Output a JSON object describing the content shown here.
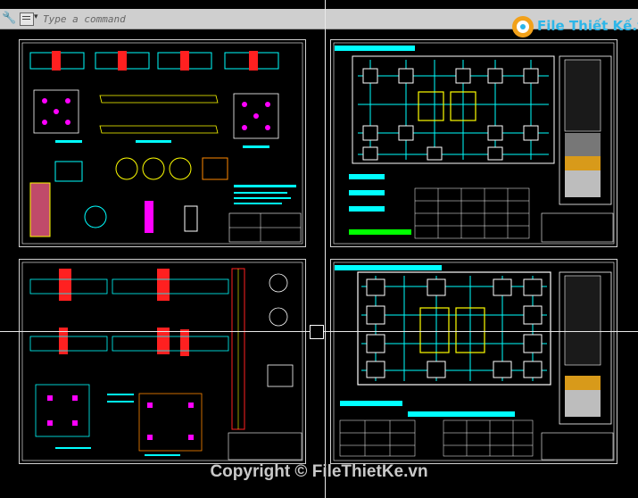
{
  "command_line": {
    "placeholder": "Type a command",
    "tool_icon": "wrench-icon",
    "history_icon": "command-history-icon"
  },
  "logo": {
    "text": "File Thiết Kế.vn",
    "icon": "filethietke-logo-icon"
  },
  "sheets": [
    {
      "id": "sheet-top-left",
      "title_block": ""
    },
    {
      "id": "sheet-top-right",
      "title_block": ""
    },
    {
      "id": "sheet-bottom-left",
      "title_block": ""
    },
    {
      "id": "sheet-bottom-right",
      "title_block": ""
    }
  ],
  "footer": {
    "copyright": "Copyright © FileThietKe.vn"
  },
  "colors": {
    "background": "#000000",
    "cyan": "#00ffff",
    "yellow": "#ffff00",
    "red": "#ff2020",
    "magenta": "#ff00ff",
    "green": "#00ff00",
    "white": "#ffffff"
  }
}
